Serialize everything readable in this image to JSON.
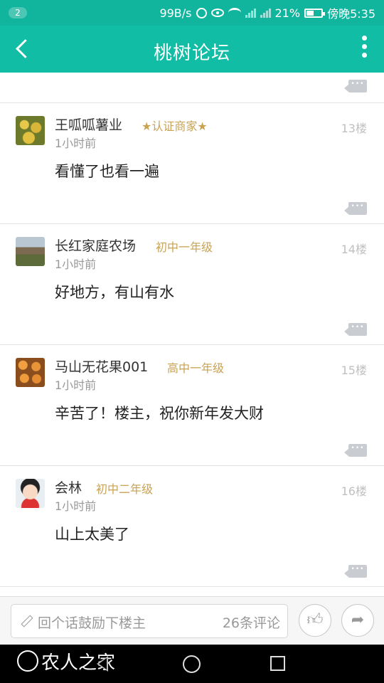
{
  "status_bar": {
    "badge": "2",
    "speed": "99B/s",
    "battery_percent": "21%",
    "time": "傍晚5:35"
  },
  "header": {
    "title": "桃树论坛"
  },
  "posts": [
    {
      "username": "王呱呱薯业",
      "badge": "★认证商家★",
      "time": "1小时前",
      "floor": "13楼",
      "content": "看懂了也看一遍"
    },
    {
      "username": "长红家庭农场",
      "badge": "初中一年级",
      "time": "1小时前",
      "floor": "14楼",
      "content": "好地方，有山有水"
    },
    {
      "username": "马山无花果001",
      "badge": "高中一年级",
      "time": "1小时前",
      "floor": "15楼",
      "content": "辛苦了！楼主，祝你新年发大财"
    },
    {
      "username": "会林",
      "badge": "初中二年级",
      "time": "1小时前",
      "floor": "16楼",
      "content": "山上太美了"
    }
  ],
  "bottom_bar": {
    "comment_placeholder": "回个话鼓励下楼主",
    "comment_count": "26条评论"
  },
  "watermark": {
    "text": "农人之家"
  },
  "colors": {
    "header_bg": "#11bda4",
    "badge": "#c9a252"
  }
}
